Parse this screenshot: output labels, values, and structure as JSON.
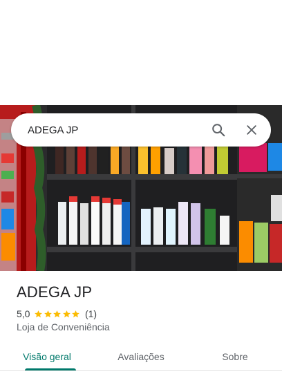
{
  "search": {
    "query": "ADEGA JP"
  },
  "place": {
    "name": "ADEGA JP",
    "rating": "5,0",
    "stars": 5,
    "review_count": "(1)",
    "category": "Loja de Conveniência"
  },
  "tabs": [
    {
      "label": "Visão geral",
      "active": true
    },
    {
      "label": "Avaliações",
      "active": false
    },
    {
      "label": "Sobre",
      "active": false
    }
  ],
  "colors": {
    "accent": "#00796b",
    "star": "#fbbc04"
  },
  "icons": [
    "search-icon",
    "close-icon",
    "star-icon"
  ]
}
